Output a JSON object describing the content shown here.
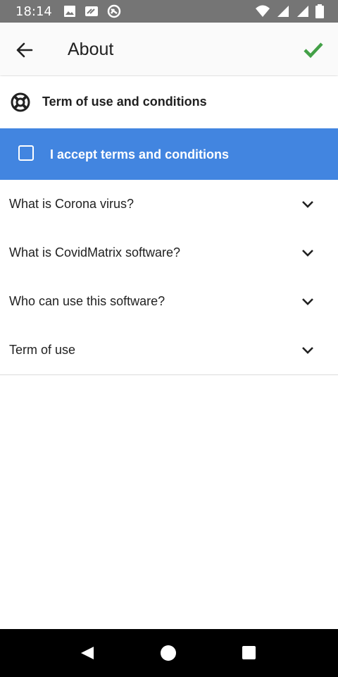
{
  "status_bar": {
    "time": "18:14",
    "left_icons": [
      "image-icon",
      "message-icon",
      "sync-icon"
    ],
    "right_icons": [
      "wifi-icon",
      "signal-icon",
      "signal-icon",
      "battery-icon"
    ]
  },
  "app_bar": {
    "back_icon": "arrow-left-icon",
    "title": "About",
    "confirm_icon": "check-icon",
    "confirm_color": "#43a047"
  },
  "section": {
    "icon": "lifebuoy-icon",
    "title": "Term of use and conditions"
  },
  "accept": {
    "label": "I accept terms and conditions",
    "checked": false,
    "background": "#4285e0"
  },
  "faq": [
    {
      "label": "What is Corona virus?",
      "icon": "chevron-down-icon"
    },
    {
      "label": "What is CovidMatrix software?",
      "icon": "chevron-down-icon"
    },
    {
      "label": "Who can use this software?",
      "icon": "chevron-down-icon"
    },
    {
      "label": "Term of use",
      "icon": "chevron-down-icon"
    }
  ],
  "nav_bar": {
    "icons": [
      "nav-back-icon",
      "nav-home-icon",
      "nav-recents-icon"
    ]
  }
}
